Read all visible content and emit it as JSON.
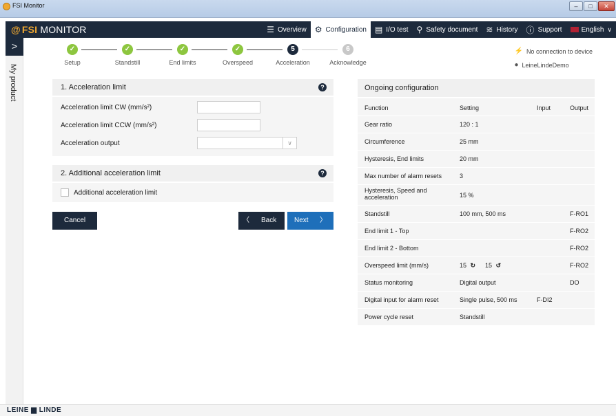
{
  "window": {
    "title": "FSI Monitor",
    "minimize": "–",
    "maximize": "□",
    "close": "✕"
  },
  "app": {
    "logo_glyph": "@",
    "logo_fsi": "FSI",
    "logo_rest": " MONITOR"
  },
  "nav": {
    "overview": "Overview",
    "configuration": "Configuration",
    "io_test": "I/O test",
    "safety_document": "Safety document",
    "history": "History",
    "support": "Support",
    "language": "English"
  },
  "sidebar": {
    "toggle_glyph": ">",
    "label": "My product"
  },
  "stepper": {
    "steps": [
      {
        "label": "Setup",
        "mark": "✓",
        "state": "done"
      },
      {
        "label": "Standstill",
        "mark": "✓",
        "state": "done"
      },
      {
        "label": "End limits",
        "mark": "✓",
        "state": "done"
      },
      {
        "label": "Overspeed",
        "mark": "✓",
        "state": "done"
      },
      {
        "label": "Acceleration",
        "mark": "5",
        "state": "current"
      },
      {
        "label": "Acknowledge",
        "mark": "6",
        "state": "todo"
      }
    ]
  },
  "status": {
    "connection": "No connection to device",
    "user": "LeineLindeDemo"
  },
  "form": {
    "section1_title": "1. Acceleration limit",
    "accel_cw_label": "Acceleration limit CW (mm/s²)",
    "accel_cw_value": "",
    "accel_ccw_label": "Acceleration limit CCW (mm/s²)",
    "accel_ccw_value": "",
    "accel_output_label": "Acceleration output",
    "accel_output_value": "",
    "section2_title": "2. Additional acceleration limit",
    "additional_checkbox_label": "Additional acceleration limit",
    "help_glyph": "?"
  },
  "buttons": {
    "cancel": "Cancel",
    "back": "Back",
    "next": "Next",
    "back_glyph": "〈",
    "next_glyph": "〉"
  },
  "ongoing": {
    "title": "Ongoing configuration",
    "headers": {
      "function": "Function",
      "setting": "Setting",
      "input": "Input",
      "output": "Output"
    },
    "rows": [
      {
        "function": "Gear ratio",
        "setting": "120 : 1",
        "input": "",
        "output": ""
      },
      {
        "function": "Circumference",
        "setting": "25 mm",
        "input": "",
        "output": ""
      },
      {
        "function": "Hysteresis, End limits",
        "setting": "20 mm",
        "input": "",
        "output": ""
      },
      {
        "function": "Max number of alarm resets",
        "setting": "3",
        "input": "",
        "output": ""
      },
      {
        "function": "Hysteresis, Speed and acceleration",
        "setting": "15 %",
        "input": "",
        "output": ""
      },
      {
        "function": "Standstill",
        "setting": "100 mm, 500 ms",
        "input": "",
        "output": "F-RO1"
      },
      {
        "function": "End limit 1 - Top",
        "setting": "",
        "input": "",
        "output": "F-RO2"
      },
      {
        "function": "End limit 2 - Bottom",
        "setting": "",
        "input": "",
        "output": "F-RO2"
      },
      {
        "function": "Overspeed limit (mm/s)",
        "setting_cw": "15",
        "setting_ccw": "15",
        "input": "",
        "output": "F-RO2"
      },
      {
        "function": "Status monitoring",
        "setting": "Digital output",
        "input": "",
        "output": "DO"
      },
      {
        "function": "Digital input for alarm reset",
        "setting": "Single pulse, 500 ms",
        "input": "F-DI2",
        "output": ""
      },
      {
        "function": "Power cycle reset",
        "setting": "Standstill",
        "input": "",
        "output": ""
      }
    ]
  },
  "footer": {
    "brand": "LEINE ▆ LINDE"
  },
  "colors": {
    "navy": "#1d2a3c",
    "done_green": "#8dc63f",
    "accent_orange": "#f0a830",
    "next_blue": "#1e6fba"
  }
}
